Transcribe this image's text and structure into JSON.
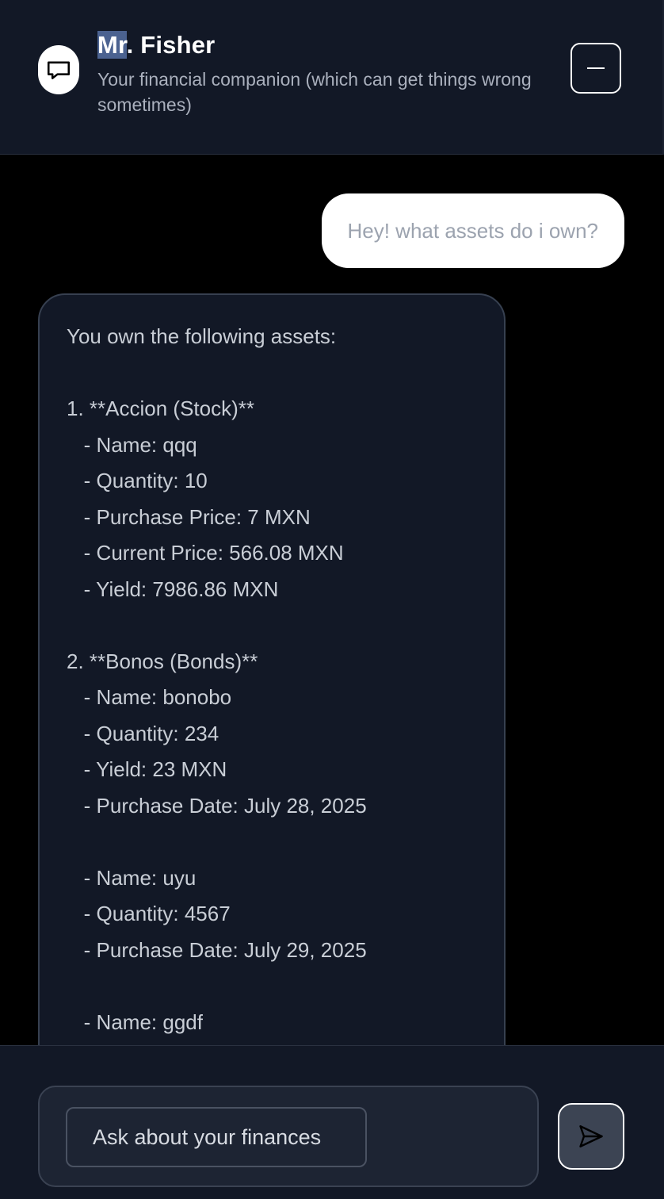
{
  "header": {
    "title_selected": "Mr",
    "title_rest": ". Fisher",
    "subtitle": "Your financial companion (which can get things wrong sometimes)",
    "avatar_icon": "chat-bubble-icon",
    "minimize_icon": "minus-icon"
  },
  "messages": {
    "user": "Hey! what assets do i own?",
    "bot_lines": [
      "You own the following assets:",
      "",
      "1. **Accion (Stock)**",
      "   - Name: qqq",
      "   - Quantity: 10",
      "   - Purchase Price: 7 MXN",
      "   - Current Price: 566.08 MXN",
      "   - Yield: 7986.86 MXN",
      "",
      "2. **Bonos (Bonds)**",
      "   - Name: bonobo",
      "   - Quantity: 234",
      "   - Yield: 23 MXN",
      "   - Purchase Date: July 28, 2025",
      "",
      "   - Name: uyu",
      "   - Quantity: 4567",
      "   - Purchase Date: July 29, 2025",
      "",
      "   - Name: ggdf"
    ]
  },
  "composer": {
    "placeholder": "Ask about your finances",
    "send_icon": "send-icon"
  },
  "colors": {
    "header_bg": "#121826",
    "page_bg": "#000000",
    "selection": "#4b6290",
    "bot_bubble_bg": "#121826",
    "user_bubble_bg": "#ffffff"
  }
}
